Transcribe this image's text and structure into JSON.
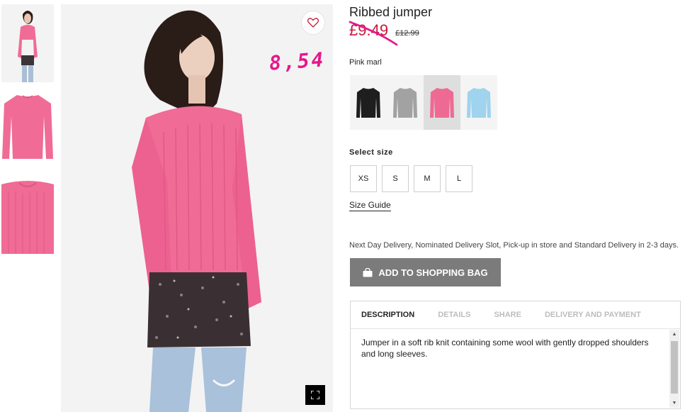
{
  "product": {
    "title": "Ribbed jumper",
    "sale_price": "£9.49",
    "old_price": "£12.99",
    "handwritten_price": "8,54",
    "color_name": "Pink marl"
  },
  "colors": {
    "accent_pink": "#e5188b",
    "sale_red": "#c6193c",
    "button_grey": "#7b7b7b",
    "jumper_pink": "#f06b96"
  },
  "swatches": [
    {
      "name": "black",
      "color": "#1e1e1e"
    },
    {
      "name": "grey",
      "color": "#a2a2a2"
    },
    {
      "name": "pink",
      "color": "#ee6a94"
    },
    {
      "name": "light blue",
      "color": "#9fd3ee"
    }
  ],
  "size_section": {
    "label": "Select size",
    "sizes": [
      "XS",
      "S",
      "M",
      "L"
    ],
    "guide_label": "Size Guide"
  },
  "delivery_text": "Next Day Delivery, Nominated Delivery Slot, Pick-up in store and Standard Delivery in 2-3 days.",
  "add_to_bag_label": "ADD TO SHOPPING BAG",
  "tabs": [
    "DESCRIPTION",
    "DETAILS",
    "SHARE",
    "DELIVERY AND PAYMENT"
  ],
  "description": "Jumper in a soft rib knit containing some wool with gently dropped shoulders and long sleeves.",
  "icons": {
    "favorite": "heart-icon",
    "zoom": "expand-icon",
    "bag": "shopping-bag-icon"
  }
}
